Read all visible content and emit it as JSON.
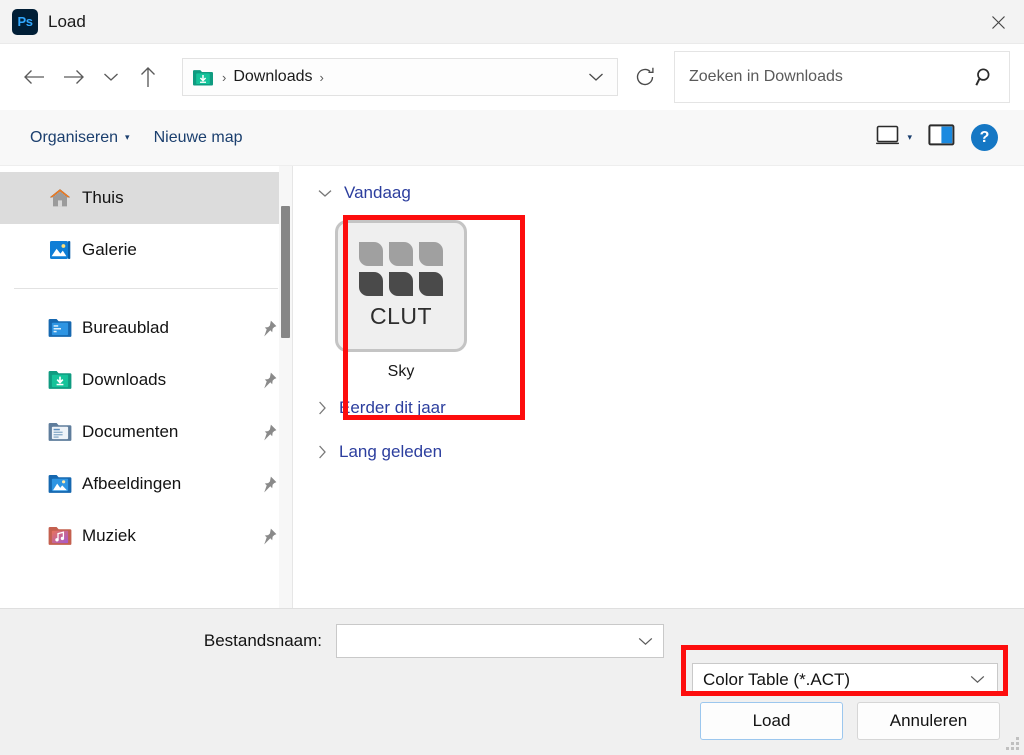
{
  "window": {
    "title": "Load",
    "app_icon": "photoshop-icon",
    "app_icon_text": "Ps",
    "close_label": "✕"
  },
  "nav": {
    "back_icon": "back-arrow-icon",
    "forward_icon": "forward-arrow-icon",
    "recent_icon": "chevron-down-icon",
    "up_icon": "up-arrow-icon",
    "refresh_icon": "refresh-icon",
    "breadcrumb": {
      "folder_icon": "downloads-folder-icon",
      "separator": "›",
      "path": "Downloads",
      "trailing_separator": "›",
      "dropdown_icon": "chevron-down-icon"
    },
    "search": {
      "placeholder": "Zoeken in Downloads",
      "value": "",
      "icon": "search-icon"
    }
  },
  "toolbar": {
    "organize_label": "Organiseren",
    "organize_caret": "▾",
    "new_folder_label": "Nieuwe map",
    "view_icon": "view-layout-icon",
    "view_caret": "▾",
    "preview_pane_icon": "preview-pane-icon",
    "help_icon": "help-icon",
    "help_label": "?"
  },
  "sidebar": {
    "items": [
      {
        "label": "Thuis",
        "icon": "home-icon",
        "selected": true,
        "pinned": false
      },
      {
        "label": "Galerie",
        "icon": "gallery-icon",
        "selected": false,
        "pinned": false
      },
      {
        "label": "Bureaublad",
        "icon": "desktop-folder-icon",
        "selected": false,
        "pinned": true
      },
      {
        "label": "Downloads",
        "icon": "downloads-folder-icon",
        "selected": false,
        "pinned": true
      },
      {
        "label": "Documenten",
        "icon": "documents-folder-icon",
        "selected": false,
        "pinned": true
      },
      {
        "label": "Afbeeldingen",
        "icon": "pictures-folder-icon",
        "selected": false,
        "pinned": true
      },
      {
        "label": "Muziek",
        "icon": "music-folder-icon",
        "selected": false,
        "pinned": true
      }
    ],
    "pin_icon": "pin-icon",
    "scrollbar": "vertical-scrollbar"
  },
  "content": {
    "groups": [
      {
        "title": "Vandaag",
        "expanded": true,
        "chevron": "chevron-down-icon"
      },
      {
        "title": "Eerder dit jaar",
        "expanded": false,
        "chevron": "chevron-right-icon"
      },
      {
        "title": "Lang geleden",
        "expanded": false,
        "chevron": "chevron-right-icon"
      }
    ],
    "files": [
      {
        "name": "Sky",
        "icon": "clut-file-icon",
        "icon_text": "CLUT",
        "swatches": [
          "light",
          "light",
          "light",
          "dark",
          "dark",
          "dark"
        ]
      }
    ]
  },
  "footer": {
    "filename_label": "Bestandsnaam:",
    "filename_value": "",
    "filename_placeholder": "",
    "filetype_value": "Color Table (*.ACT)",
    "combo_caret_icon": "chevron-down-icon",
    "load_button": "Load",
    "cancel_button": "Annuleren",
    "resize_grip": "resize-grip"
  },
  "annotations": {
    "highlight_color": "#fd0d0d",
    "boxes": [
      {
        "target": "file-tile-sky"
      },
      {
        "target": "filetype-combobox"
      }
    ]
  },
  "colors": {
    "accent": "#1577c4",
    "link": "#2c3e9e",
    "toolbar_text": "#1b3f6e",
    "highlight": "#fd0d0d"
  }
}
